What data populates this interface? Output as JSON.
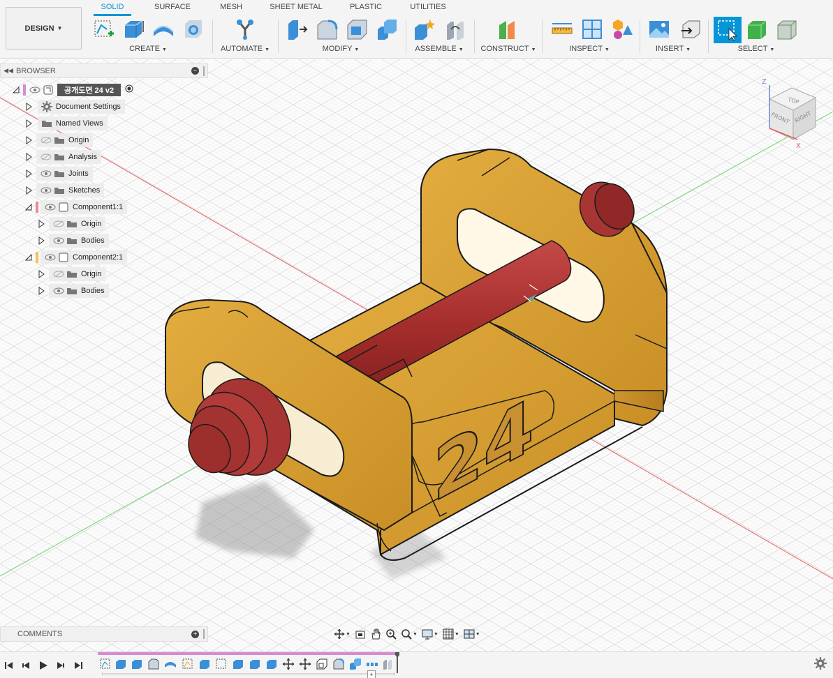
{
  "workspace": {
    "label": "DESIGN"
  },
  "tabs": [
    {
      "label": "SOLID",
      "active": true
    },
    {
      "label": "SURFACE"
    },
    {
      "label": "MESH"
    },
    {
      "label": "SHEET METAL"
    },
    {
      "label": "PLASTIC"
    },
    {
      "label": "UTILITIES"
    }
  ],
  "groups": {
    "create": "CREATE",
    "automate": "AUTOMATE",
    "modify": "MODIFY",
    "assemble": "ASSEMBLE",
    "construct": "CONSTRUCT",
    "inspect": "INSPECT",
    "insert": "INSERT",
    "select": "SELECT"
  },
  "browser": {
    "title": "BROWSER",
    "root": {
      "label": "공개도면 24 v2"
    },
    "items": [
      {
        "label": "Document Settings"
      },
      {
        "label": "Named Views"
      },
      {
        "label": "Origin"
      },
      {
        "label": "Analysis"
      },
      {
        "label": "Joints"
      },
      {
        "label": "Sketches"
      },
      {
        "label": "Component1:1"
      },
      {
        "label": "Origin"
      },
      {
        "label": "Bodies"
      },
      {
        "label": "Component2:1"
      },
      {
        "label": "Origin"
      },
      {
        "label": "Bodies"
      }
    ]
  },
  "viewcube": {
    "top": "TOP",
    "front": "FRONT",
    "right": "RIGHT",
    "axis_z": "Z",
    "axis_x": "X"
  },
  "model": {
    "engraved_text": "24"
  },
  "colors": {
    "accent": "#0696d7",
    "body_gold": "#d9a338",
    "shaft_red": "#a3302e",
    "component1": "#e88b93",
    "component2": "#f0c456",
    "root": "#d48fd6"
  },
  "comments": {
    "title": "COMMENTS"
  },
  "icons": {
    "navbar": [
      "orbit-icon",
      "look-at-icon",
      "pan-icon",
      "zoom-icon",
      "fit-icon",
      "display-settings-icon",
      "grid-icon",
      "viewports-icon"
    ],
    "timeline": [
      "first-icon",
      "previous-icon",
      "play-icon",
      "next-icon",
      "last-icon",
      "settings-icon"
    ]
  }
}
